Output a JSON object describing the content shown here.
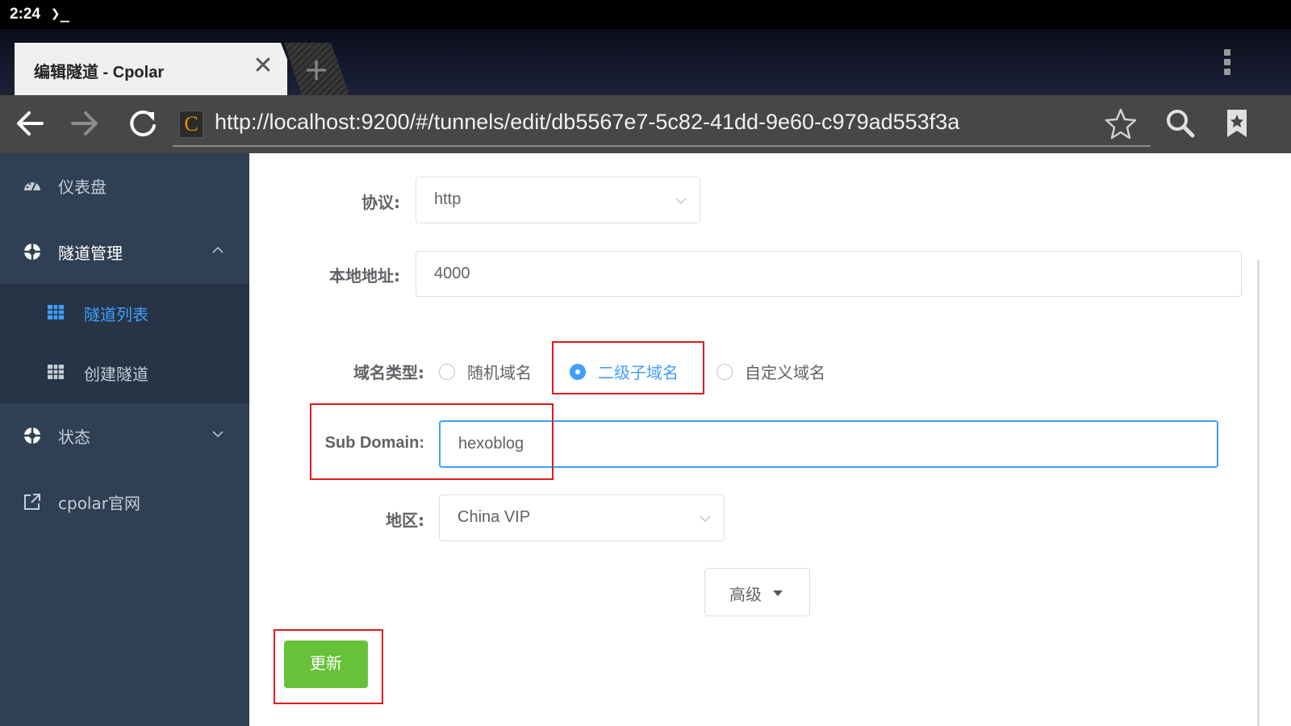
{
  "status_bar": {
    "time": "2:24",
    "terminal_glyph": "❯_"
  },
  "browser": {
    "tab_title": "编辑隧道 - Cpolar",
    "url": "http://localhost:9200/#/tunnels/edit/db5567e7-5c82-41dd-9e60-c979ad553f3a",
    "favicon_letter": "C",
    "icons": [
      "back-arrow-icon",
      "forward-arrow-icon",
      "reload-icon",
      "star-icon",
      "search-icon",
      "bookmarks-icon",
      "overflow-menu-icon",
      "close-icon",
      "plus-icon"
    ]
  },
  "sidebar": {
    "dashboard": "仪表盘",
    "tunnel_mgmt": "隧道管理",
    "tunnel_list": "隧道列表",
    "create_tunnel": "创建隧道",
    "status": "状态",
    "website": "cpolar官网"
  },
  "form": {
    "protocol_label": "协议:",
    "protocol_value": "http",
    "local_addr_label": "本地地址:",
    "local_addr_value": "4000",
    "domain_type_label": "域名类型:",
    "domain_type_options": [
      "随机域名",
      "二级子域名",
      "自定义域名"
    ],
    "domain_type_selected": "二级子域名",
    "subdomain_label": "Sub Domain:",
    "subdomain_value": "hexoblog",
    "region_label": "地区:",
    "region_value": "China VIP",
    "advanced_label": "高级",
    "update_label": "更新"
  },
  "colors": {
    "accent": "#409eff",
    "sidebar_bg": "#2f4055",
    "update_green": "#67c23a",
    "highlight_red": "#e21b1b"
  }
}
